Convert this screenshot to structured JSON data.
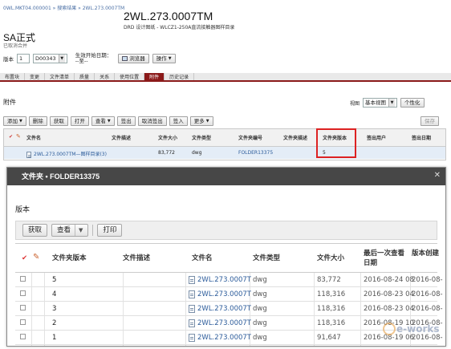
{
  "breadcrumb": "0WL.MKT04.000001 » 搜索结果 » 2WL.273.0007TM",
  "document": {
    "title": "2WL.273.0007TM",
    "subtitle": "DRD 设计图纸 - WLCZ1-250A直流接触器图样目录"
  },
  "sa": {
    "title": "SA正式",
    "status": "已取消合并"
  },
  "version_row": {
    "label_version": "版本",
    "version_value": "1",
    "iteration_value": "D00343",
    "effective_label": "生效开始日期：",
    "effective_value": "--至--",
    "browser_button": "浏览器",
    "operate_button": "操作"
  },
  "tabs": [
    {
      "label": "布置块",
      "active": false
    },
    {
      "label": "变更",
      "active": false
    },
    {
      "label": "文件清单",
      "active": false
    },
    {
      "label": "质量",
      "active": false
    },
    {
      "label": "关系",
      "active": false
    },
    {
      "label": "使用位置",
      "active": false
    },
    {
      "label": "附件",
      "active": true
    },
    {
      "label": "历史记录",
      "active": false
    }
  ],
  "attachments": {
    "label": "附件",
    "view_label": "视图",
    "view_value": "基本视图",
    "personalize_button": "个性化",
    "toolbar": [
      "添加",
      "删除",
      "获取",
      "打开",
      "查看",
      "签出",
      "取消签出",
      "签入",
      "更多"
    ],
    "save_label": "保存",
    "columns": [
      "文件名",
      "文件描述",
      "文件大小",
      "文件类型",
      "文件夹编号",
      "文件夹描述",
      "文件夹版本",
      "签出用户",
      "签出日期"
    ],
    "row": {
      "filename": "2WL.273.0007TM—图样目录(3)",
      "description": "",
      "size": "83,772",
      "type": "dwg",
      "folder_number": "FOLDER13375",
      "folder_description": "",
      "folder_version": "5",
      "checkout_user": "",
      "checkout_date": ""
    }
  },
  "dialog": {
    "title": "文件夹 • FOLDER13375",
    "section": "版本",
    "toolbar": {
      "get": "获取",
      "view": "查看",
      "print": "打印"
    },
    "columns": {
      "folder_version": "文件夹版本",
      "file_desc": "文件描述",
      "file_name": "文件名",
      "file_type": "文件类型",
      "file_size": "文件大小",
      "last_viewed_1": "最后一次查看",
      "last_viewed_2": "日期",
      "version_created": "版本创建"
    },
    "rows": [
      {
        "version": "5",
        "desc": "",
        "name": "2WL.273.0007T",
        "type": "dwg",
        "size": "83,772",
        "date": "2016-08-24 08",
        "created": "2016-08-"
      },
      {
        "version": "4",
        "desc": "",
        "name": "2WL.273.0007T",
        "type": "dwg",
        "size": "118,316",
        "date": "2016-08-23 04",
        "created": "2016-08-"
      },
      {
        "version": "3",
        "desc": "",
        "name": "2WL.273.0007T",
        "type": "dwg",
        "size": "118,316",
        "date": "2016-08-23 04",
        "created": "2016-08-"
      },
      {
        "version": "2",
        "desc": "",
        "name": "2WL.273.0007T",
        "type": "dwg",
        "size": "118,316",
        "date": "2016-08-19 10",
        "created": "2016-08-"
      },
      {
        "version": "1",
        "desc": "",
        "name": "2WL.273.0007T",
        "type": "dwg",
        "size": "91,647",
        "date": "2016-08-19 06",
        "created": "2016-08-"
      }
    ]
  },
  "watermark": "e-works",
  "colors": {
    "accent": "#8b1a1a",
    "link": "#2b5b9a",
    "highlight": "#dd2222",
    "dialog_header": "#474747"
  }
}
